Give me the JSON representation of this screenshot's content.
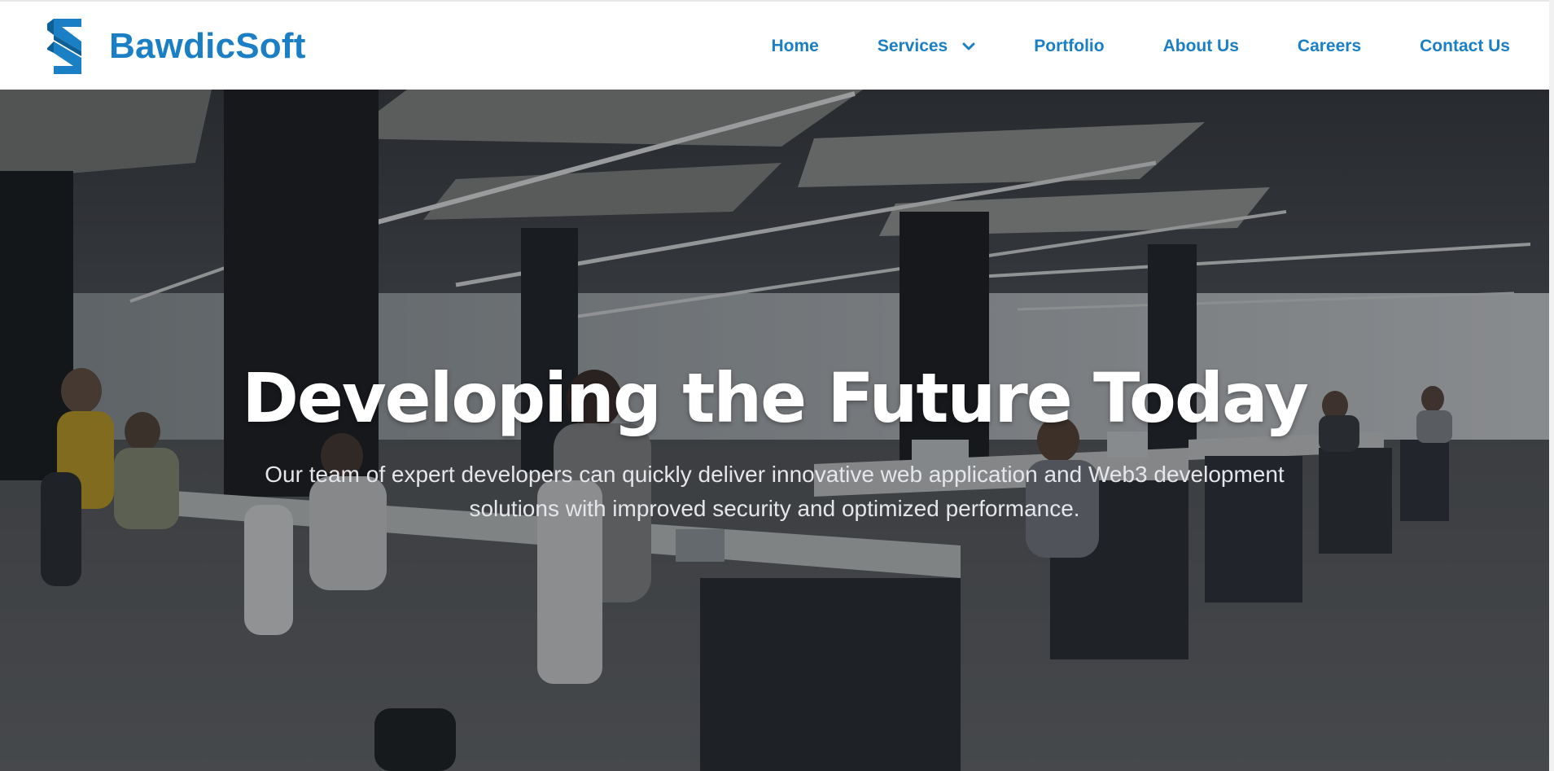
{
  "brand": {
    "name": "BawdicSoft",
    "logo_icon": "bawdicsoft-s-logo-icon",
    "color": "#1a7fc4"
  },
  "nav": {
    "items": [
      {
        "label": "Home"
      },
      {
        "label": "Services",
        "icon": "chevron-down-icon"
      },
      {
        "label": "Portfolio"
      },
      {
        "label": "About Us"
      },
      {
        "label": "Careers"
      },
      {
        "label": "Contact Us"
      }
    ]
  },
  "hero": {
    "title": "Developing the Future Today",
    "subtitle": "Our team of expert developers can quickly deliver innovative web application and Web3 development solutions with improved security and optimized performance.",
    "background": "open-plan-office-photo"
  }
}
